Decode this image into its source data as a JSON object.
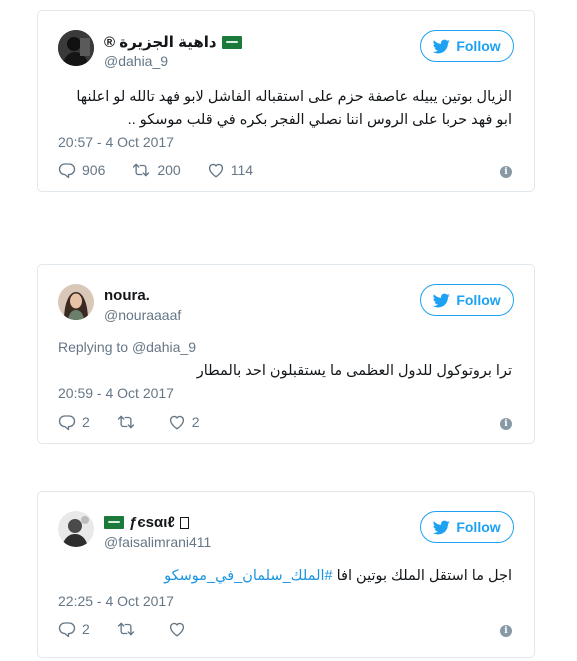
{
  "tweets": [
    {
      "display_name": "داهية الجزيرة ®",
      "handle": "@dahia_9",
      "follow_label": "Follow",
      "text": "الزيال بوتين يبيله عاصفة حزم على استقباله الفاشل لابو فهد تالله لو اعلنها ابو فهد حربا على الروس اننا نصلي الفجر بكره في قلب موسكو ..",
      "timestamp": "20:57 - 4 Oct 2017",
      "replies": "906",
      "retweets": "200",
      "likes": "114"
    },
    {
      "display_name": "noura.",
      "handle": "@nouraaaaf",
      "follow_label": "Follow",
      "replying_prefix": "Replying to",
      "replying_handle": "@dahia_9",
      "text": "ترا بروتوكول للدول العظمى ما يستقبلون احد بالمطار",
      "timestamp": "20:59 - 4 Oct 2017",
      "replies": "2",
      "retweets": "",
      "likes": "2"
    },
    {
      "display_name": "ƒєѕαιℓ",
      "handle": "@faisalimrani411",
      "follow_label": "Follow",
      "text_prefix": "اجل ما استقل الملك بوتين افا",
      "hashtag": "#الملك_سلمان_في_موسكو",
      "timestamp": "22:25 - 4 Oct 2017",
      "replies": "2",
      "retweets": "",
      "likes": ""
    }
  ],
  "colors": {
    "accent": "#1da1f2",
    "secondary_text": "#657786",
    "border": "#e1e8ed",
    "flag_green": "#1b7a3a"
  },
  "icons": [
    "twitter-bird-icon",
    "reply-icon",
    "retweet-icon",
    "like-icon",
    "info-icon",
    "saudi-flag-icon"
  ]
}
